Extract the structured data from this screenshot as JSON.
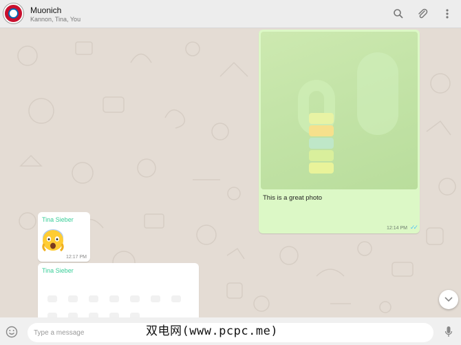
{
  "header": {
    "title": "Muonich",
    "subtitle": "Kannon, Tina, You",
    "avatar_icon": "fc-bayern-logo-icon",
    "actions": [
      "search-icon",
      "paperclip-icon",
      "more-vert-icon"
    ]
  },
  "messages": {
    "outgoing_photo": {
      "caption": "This is a great photo",
      "time": "12:14 PM",
      "status_icon": "double-check-icon"
    },
    "incoming_emoji": {
      "sender": "Tina Sieber",
      "emoji_icon": "screaming-face-emoji-icon",
      "time": "12:17 PM"
    },
    "incoming_partial": {
      "sender": "Tina Sieber"
    }
  },
  "composer": {
    "placeholder": "Type a message",
    "emoji_icon": "smiley-icon",
    "mic_icon": "microphone-icon"
  },
  "scroll_down_icon": "chevron-down-icon",
  "watermark": "双电网(www.pcpc.me)",
  "colors": {
    "wallpaper": "#e4dcd4",
    "outgoing_bubble": "#dcf8c6",
    "sender_name": "#35cd96",
    "read_ticks": "#4fc3f7"
  }
}
